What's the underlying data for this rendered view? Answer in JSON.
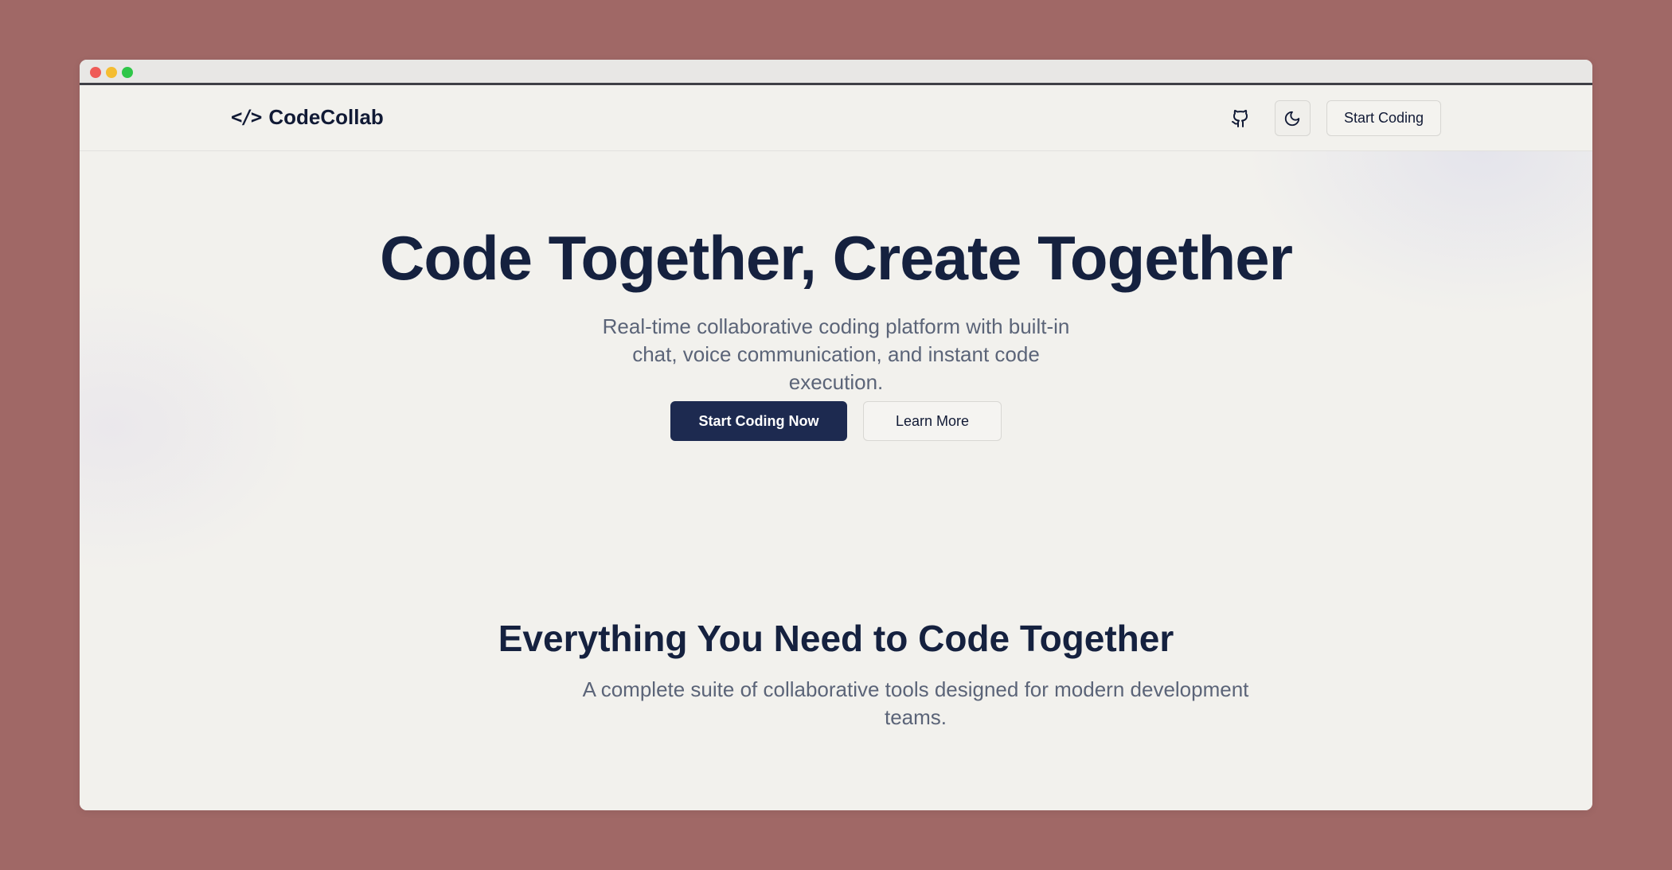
{
  "brand": {
    "icon_text": "</>",
    "name": "CodeCollab"
  },
  "navbar": {
    "github_icon": "github-icon",
    "theme_icon": "moon-icon",
    "start_button_label": "Start Coding"
  },
  "hero": {
    "title": "Code Together, Create Together",
    "subtitle": "Real-time collaborative coding platform with built-in chat, voice communication, and instant code execution.",
    "primary_button_label": "Start Coding Now",
    "secondary_button_label": "Learn More"
  },
  "features": {
    "title": "Everything You Need to Code Together",
    "subtitle": "A complete suite of collaborative tools designed for modern development teams."
  },
  "colors": {
    "background": "#a06866",
    "page": "#f2f1ed",
    "primary_button": "#1d2a50",
    "heading": "#15213f",
    "body_text": "#5b6478"
  }
}
